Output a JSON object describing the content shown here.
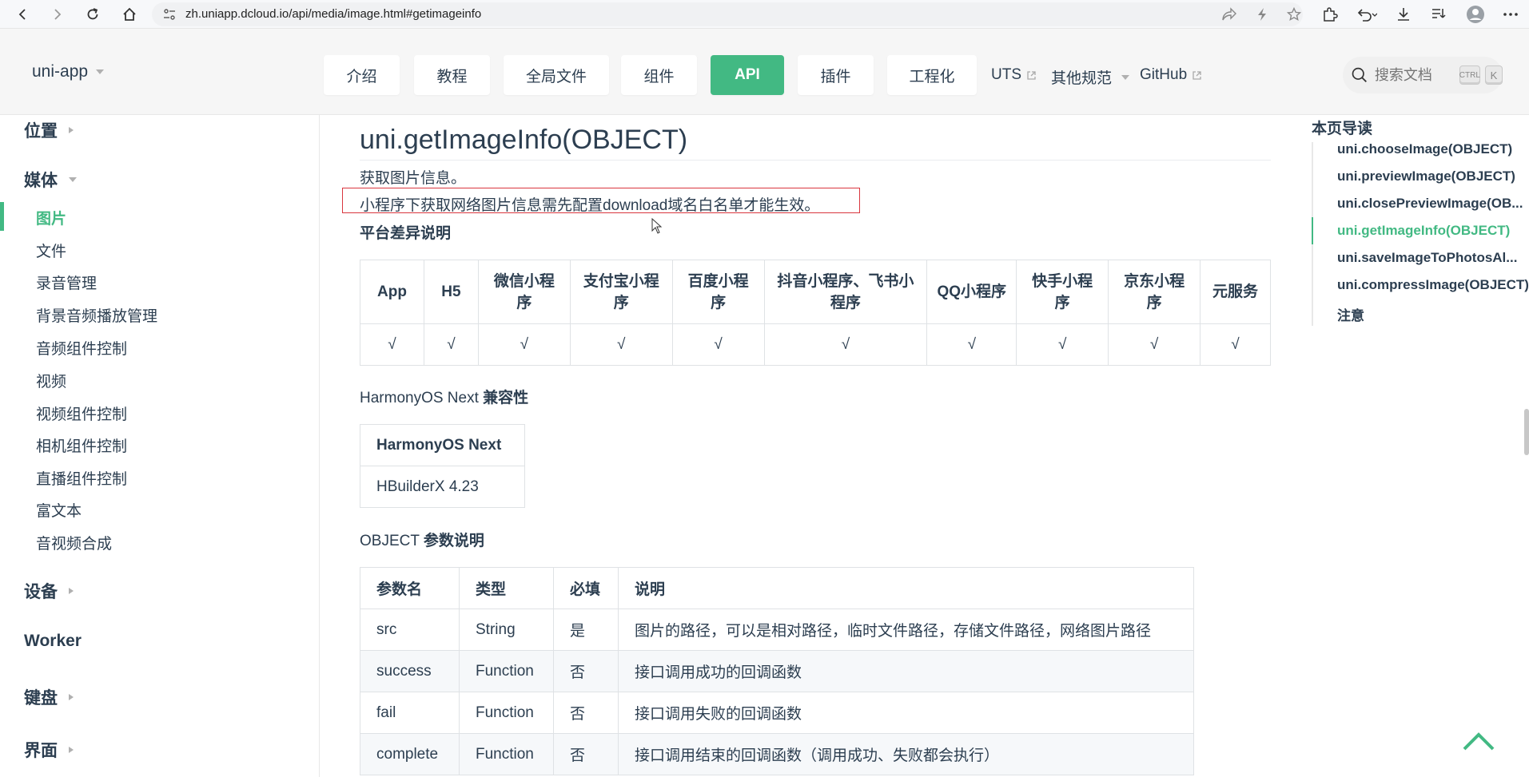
{
  "browser": {
    "url": "zh.uniapp.dcloud.io/api/media/image.html#getimageinfo"
  },
  "header": {
    "brand": "uni-app",
    "nav": [
      {
        "label": "介绍"
      },
      {
        "label": "教程"
      },
      {
        "label": "全局文件"
      },
      {
        "label": "组件"
      },
      {
        "label": "API",
        "active": true
      },
      {
        "label": "插件"
      },
      {
        "label": "工程化"
      }
    ],
    "links": {
      "uts": "UTS",
      "other": "其他规范",
      "github": "GitHub"
    },
    "search": {
      "placeholder": "搜索文档",
      "kbd1": "CTRL",
      "kbd2": "K"
    }
  },
  "sidebar": {
    "groups": {
      "location": "位置",
      "media": "媒体",
      "device": "设备",
      "worker": "Worker",
      "keyboard": "键盘",
      "ui": "界面"
    },
    "items": [
      {
        "label": "图片",
        "active": true
      },
      {
        "label": "文件"
      },
      {
        "label": "录音管理"
      },
      {
        "label": "背景音频播放管理"
      },
      {
        "label": "音频组件控制"
      },
      {
        "label": "视频"
      },
      {
        "label": "视频组件控制"
      },
      {
        "label": "相机组件控制"
      },
      {
        "label": "直播组件控制"
      },
      {
        "label": "富文本"
      },
      {
        "label": "音视频合成"
      }
    ]
  },
  "main": {
    "title": "uni.getImageInfo(OBJECT)",
    "desc": "获取图片信息。",
    "note": "小程序下获取网络图片信息需先配置download域名白名单才能生效。",
    "platform_heading": "平台差异说明",
    "platform_table": {
      "headers": [
        "App",
        "H5",
        "微信小程序",
        "支付宝小程序",
        "百度小程序",
        "抖音小程序、飞书小程序",
        "QQ小程序",
        "快手小程序",
        "京东小程序",
        "元服务"
      ],
      "values": [
        "√",
        "√",
        "√",
        "√",
        "√",
        "√",
        "√",
        "√",
        "√",
        "√"
      ]
    },
    "harmony_heading_a": "HarmonyOS Next",
    "harmony_heading_b": "兼容性",
    "harmony_table": {
      "header": "HarmonyOS Next",
      "value": "HBuilderX 4.23"
    },
    "object_heading_a": "OBJECT",
    "object_heading_b": "参数说明",
    "param_table": {
      "headers": [
        "参数名",
        "类型",
        "必填",
        "说明"
      ],
      "rows": [
        [
          "src",
          "String",
          "是",
          "图片的路径，可以是相对路径，临时文件路径，存储文件路径，网络图片路径"
        ],
        [
          "success",
          "Function",
          "否",
          "接口调用成功的回调函数"
        ],
        [
          "fail",
          "Function",
          "否",
          "接口调用失败的回调函数"
        ],
        [
          "complete",
          "Function",
          "否",
          "接口调用结束的回调函数（调用成功、失败都会执行）"
        ]
      ]
    }
  },
  "toc": {
    "title": "本页导读",
    "items": [
      {
        "label": "uni.chooseImage(OBJECT)"
      },
      {
        "label": "uni.previewImage(OBJECT)"
      },
      {
        "label": "uni.closePreviewImage(OB..."
      },
      {
        "label": "uni.getImageInfo(OBJECT)",
        "active": true
      },
      {
        "label": "uni.saveImageToPhotosAl..."
      },
      {
        "label": "uni.compressImage(OBJECT)"
      },
      {
        "label": "注意"
      }
    ]
  },
  "colors": {
    "accent": "#42b983",
    "text": "#2c3e50",
    "highlight_border": "#d9363e"
  }
}
